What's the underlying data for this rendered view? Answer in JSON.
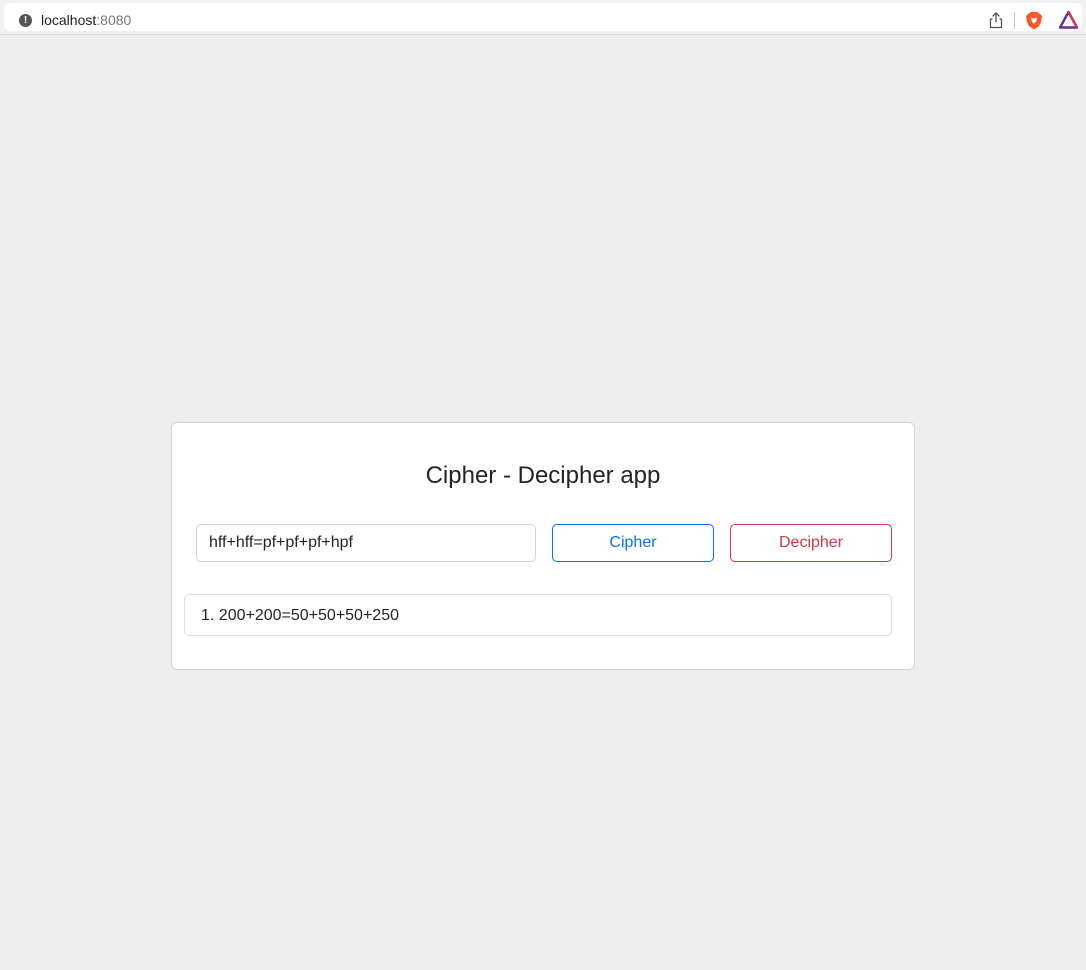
{
  "browser": {
    "url_host": "localhost",
    "url_port": ":8080",
    "icons": [
      "info-icon",
      "share-icon",
      "brave-shield-icon",
      "brave-rewards-icon"
    ]
  },
  "app": {
    "title": "Cipher - Decipher app",
    "input": {
      "value": "hff+hff=pf+pf+pf+hpf",
      "placeholder": ""
    },
    "cipher_label": "Cipher",
    "decipher_label": "Decipher",
    "results": [
      {
        "number": "1.",
        "text": "200+200=50+50+50+250"
      }
    ]
  },
  "colors": {
    "background": "#eeeeee",
    "cipher_accent": "#0d6efd",
    "decipher_accent": "#dc3545",
    "text": "#212529"
  }
}
